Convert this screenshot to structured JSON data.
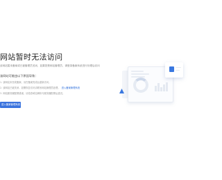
{
  "heading": "网站暂时无法访问",
  "description": "该网站暂未备案或已被管理员关闭，如果您是网站管理员，请登录备案系统进行处理后访问",
  "reasons": {
    "title": "该网站可能由以下原因导致：",
    "items": [
      {
        "text": "1. 该网站未完成备案，请在备案完成后重新访问。"
      },
      {
        "text": "2. 该网站已被关闭，如需恢复访问请联系网站管理员处理，",
        "link": "进入备案管理系统"
      },
      {
        "text": "3. 网站服务器配置错误，请检查域名解析与服务器配置后重试。"
      }
    ]
  },
  "cta_label": "进入备案管理系统",
  "colors": {
    "accent": "#3a73de",
    "text": "#222222",
    "muted": "#999999"
  }
}
